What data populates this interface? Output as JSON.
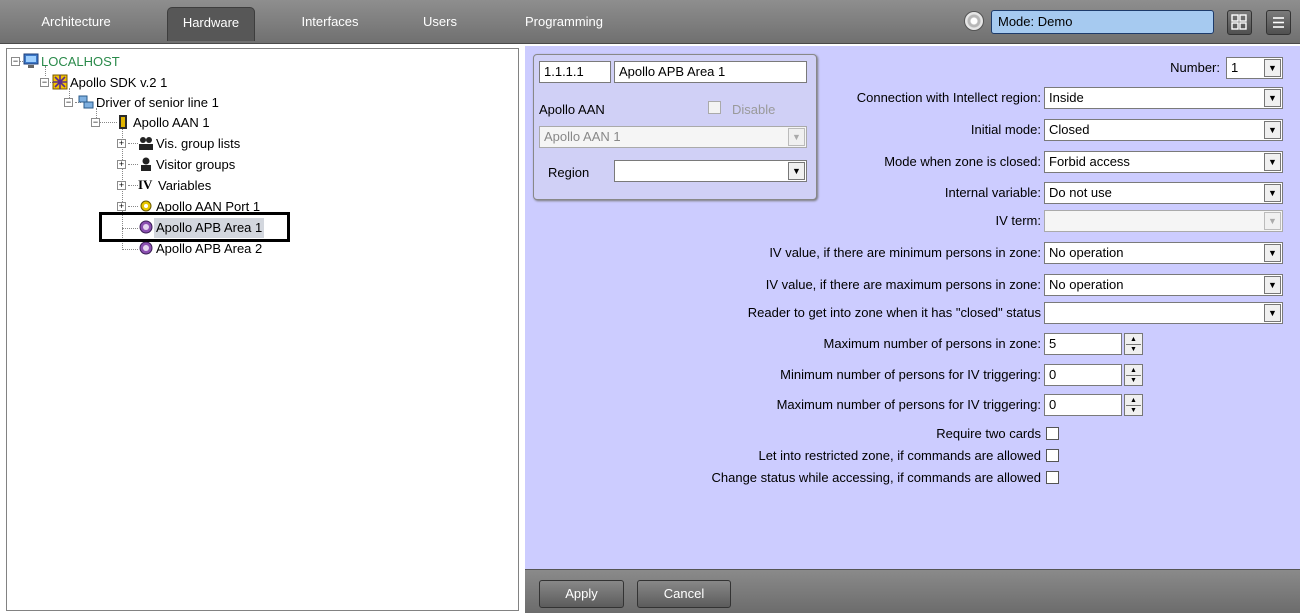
{
  "tabs": [
    {
      "label": "Architecture"
    },
    {
      "label": "Hardware"
    },
    {
      "label": "Interfaces"
    },
    {
      "label": "Users"
    },
    {
      "label": "Programming"
    }
  ],
  "active_tab": "Hardware",
  "mode": {
    "value": "Mode: Demo"
  },
  "tree": {
    "root": "LOCALHOST",
    "sdk": "Apollo SDK v.2 1",
    "driver": "Driver of senior line 1",
    "aan": "Apollo AAN 1",
    "vis_group_lists": "Vis. group lists",
    "visitor_groups": "Visitor groups",
    "variables": "Variables",
    "aan_port": "Apollo AAN Port 1",
    "apb_area_1": "Apollo APB Area 1",
    "apb_area_2": "Apollo APB Area 2",
    "selected": "Apollo APB Area 1"
  },
  "object": {
    "id": "1.1.1.1",
    "name": "Apollo APB Area 1",
    "parent_type": "Apollo AAN",
    "disable_label": "Disable",
    "parent_value": "Apollo AAN 1",
    "region_label": "Region",
    "region_value": ""
  },
  "settings": {
    "number_label": "Number:",
    "number_value": "1",
    "connection_label": "Connection with Intellect region:",
    "connection_value": "Inside",
    "initial_mode_label": "Initial mode:",
    "initial_mode_value": "Closed",
    "mode_closed_label": "Mode when zone is closed:",
    "mode_closed_value": "Forbid access",
    "internal_var_label": "Internal variable:",
    "internal_var_value": "Do not use",
    "iv_term_label": "IV term:",
    "iv_term_value": "",
    "iv_min_label": "IV value, if there are minimum persons in zone:",
    "iv_min_value": "No operation",
    "iv_max_label": "IV value, if there are maximum persons in zone:",
    "iv_max_value": "No operation",
    "reader_label": "Reader to get into zone when it has \"closed\" status",
    "reader_value": "",
    "max_persons_label": "Maximum number of persons in zone:",
    "max_persons_value": "5",
    "min_iv_label": "Minimum number of persons for IV triggering:",
    "min_iv_value": "0",
    "max_iv_label": "Maximum number of persons for IV triggering:",
    "max_iv_value": "0",
    "two_cards_label": "Require two cards",
    "restricted_label": "Let into restricted zone, if commands are allowed",
    "change_status_label": "Change status while accessing, if commands are allowed"
  },
  "buttons": {
    "apply": "Apply",
    "cancel": "Cancel"
  },
  "icons": {
    "root": "computer-icon",
    "sdk": "apollo-sdk-icon",
    "driver": "network-driver-icon",
    "aan": "controller-icon",
    "vis_group_lists": "people-icon",
    "visitor_groups": "person-icon",
    "variables": "iv-icon",
    "aan_port": "port-icon",
    "apb_area": "area-icon"
  },
  "colors": {
    "panel_bg": "#ccccff",
    "mode_bg": "#a6caf0",
    "root_text": "#2a8a4a"
  }
}
